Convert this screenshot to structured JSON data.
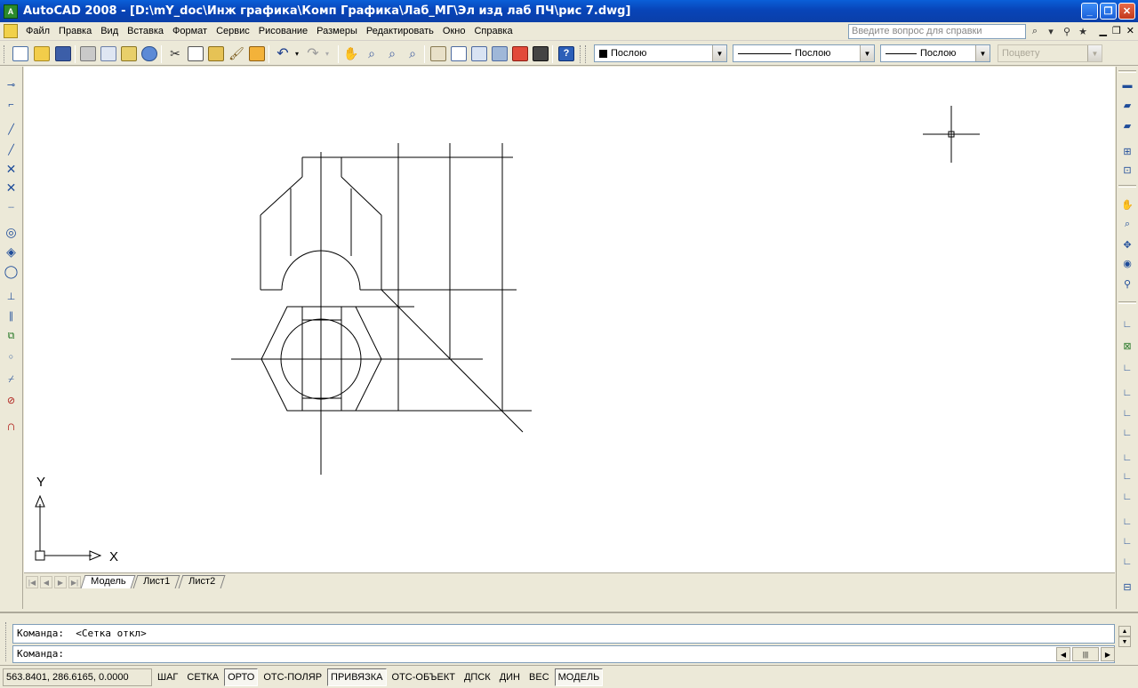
{
  "window": {
    "title": "AutoCAD 2008 - [D:\\mY_doc\\Инж графика\\Комп Графика\\Лаб_МГ\\Эл изд лаб ПЧ\\рис 7.dwg]",
    "app_icon_text": "A"
  },
  "menu": {
    "items": [
      "Файл",
      "Правка",
      "Вид",
      "Вставка",
      "Формат",
      "Сервис",
      "Рисование",
      "Размеры",
      "Редактировать",
      "Окно",
      "Справка"
    ],
    "help_placeholder": "Введите вопрос для справки"
  },
  "properties": {
    "color": "Послою",
    "linetype": "Послою",
    "lineweight": "Послою",
    "plotstyle": "Поцвету"
  },
  "ucs": {
    "x_label": "X",
    "y_label": "Y"
  },
  "tabs": [
    "Модель",
    "Лист1",
    "Лист2"
  ],
  "command": {
    "history": "Команда:  <Сетка откл>",
    "prompt": "Команда:"
  },
  "status": {
    "coordinates": "563.8401, 286.6165, 0.0000",
    "buttons": [
      {
        "label": "ШАГ",
        "on": false
      },
      {
        "label": "СЕТКА",
        "on": false
      },
      {
        "label": "ОРТО",
        "on": true
      },
      {
        "label": "ОТС-ПОЛЯР",
        "on": false
      },
      {
        "label": "ПРИВЯЗКА",
        "on": true
      },
      {
        "label": "ОТС-ОБЪЕКТ",
        "on": false
      },
      {
        "label": "ДПСК",
        "on": false
      },
      {
        "label": "ДИН",
        "on": false
      },
      {
        "label": "ВЕС",
        "on": false
      },
      {
        "label": "МОДЕЛЬ",
        "on": true
      }
    ]
  },
  "colors": {
    "titlebar": "#0a4fc8",
    "chrome": "#ece9d8",
    "canvas_background": "#ffffff",
    "drawing_lines": "#000000"
  }
}
